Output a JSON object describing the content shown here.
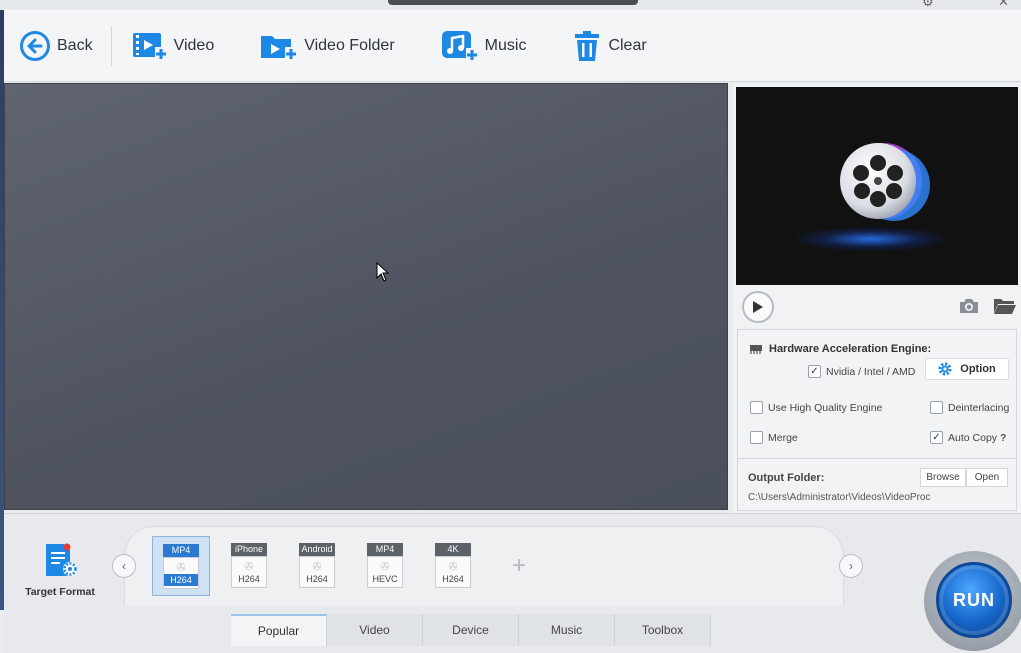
{
  "toolbar": {
    "back_label": "Back",
    "video_label": "Video",
    "video_folder_label": "Video Folder",
    "music_label": "Music",
    "clear_label": "Clear"
  },
  "settings": {
    "hw_title": "Hardware Acceleration Engine:",
    "nvidia_label": "Nvidia / Intel / AMD",
    "nvidia_checked": true,
    "option_label": "Option",
    "high_quality_label": "Use High Quality Engine",
    "high_quality_checked": false,
    "deinterlacing_label": "Deinterlacing",
    "deinterlacing_checked": false,
    "merge_label": "Merge",
    "merge_checked": false,
    "auto_copy_label": "Auto Copy",
    "auto_copy_checked": true,
    "help_mark": "?",
    "output_folder_label": "Output Folder:",
    "browse_label": "Browse",
    "open_label": "Open",
    "output_path": "C:\\Users\\Administrator\\Videos\\VideoProc"
  },
  "bottom": {
    "target_format_label": "Target Format",
    "formats": [
      {
        "tag": "MP4",
        "codec": "H264",
        "selected": true
      },
      {
        "tag": "iPhone",
        "codec": "H264",
        "selected": false
      },
      {
        "tag": "Android",
        "codec": "H264",
        "selected": false
      },
      {
        "tag": "MP4",
        "codec": "HEVC",
        "selected": false
      },
      {
        "tag": "4K",
        "codec": "H264",
        "selected": false
      }
    ],
    "tabs": [
      "Popular",
      "Video",
      "Device",
      "Music",
      "Toolbox"
    ],
    "active_tab": "Popular",
    "run_label": "RUN"
  },
  "colors": {
    "accent": "#1e88e5",
    "run_blue": "#1565c8",
    "canvas": "#555a65"
  }
}
